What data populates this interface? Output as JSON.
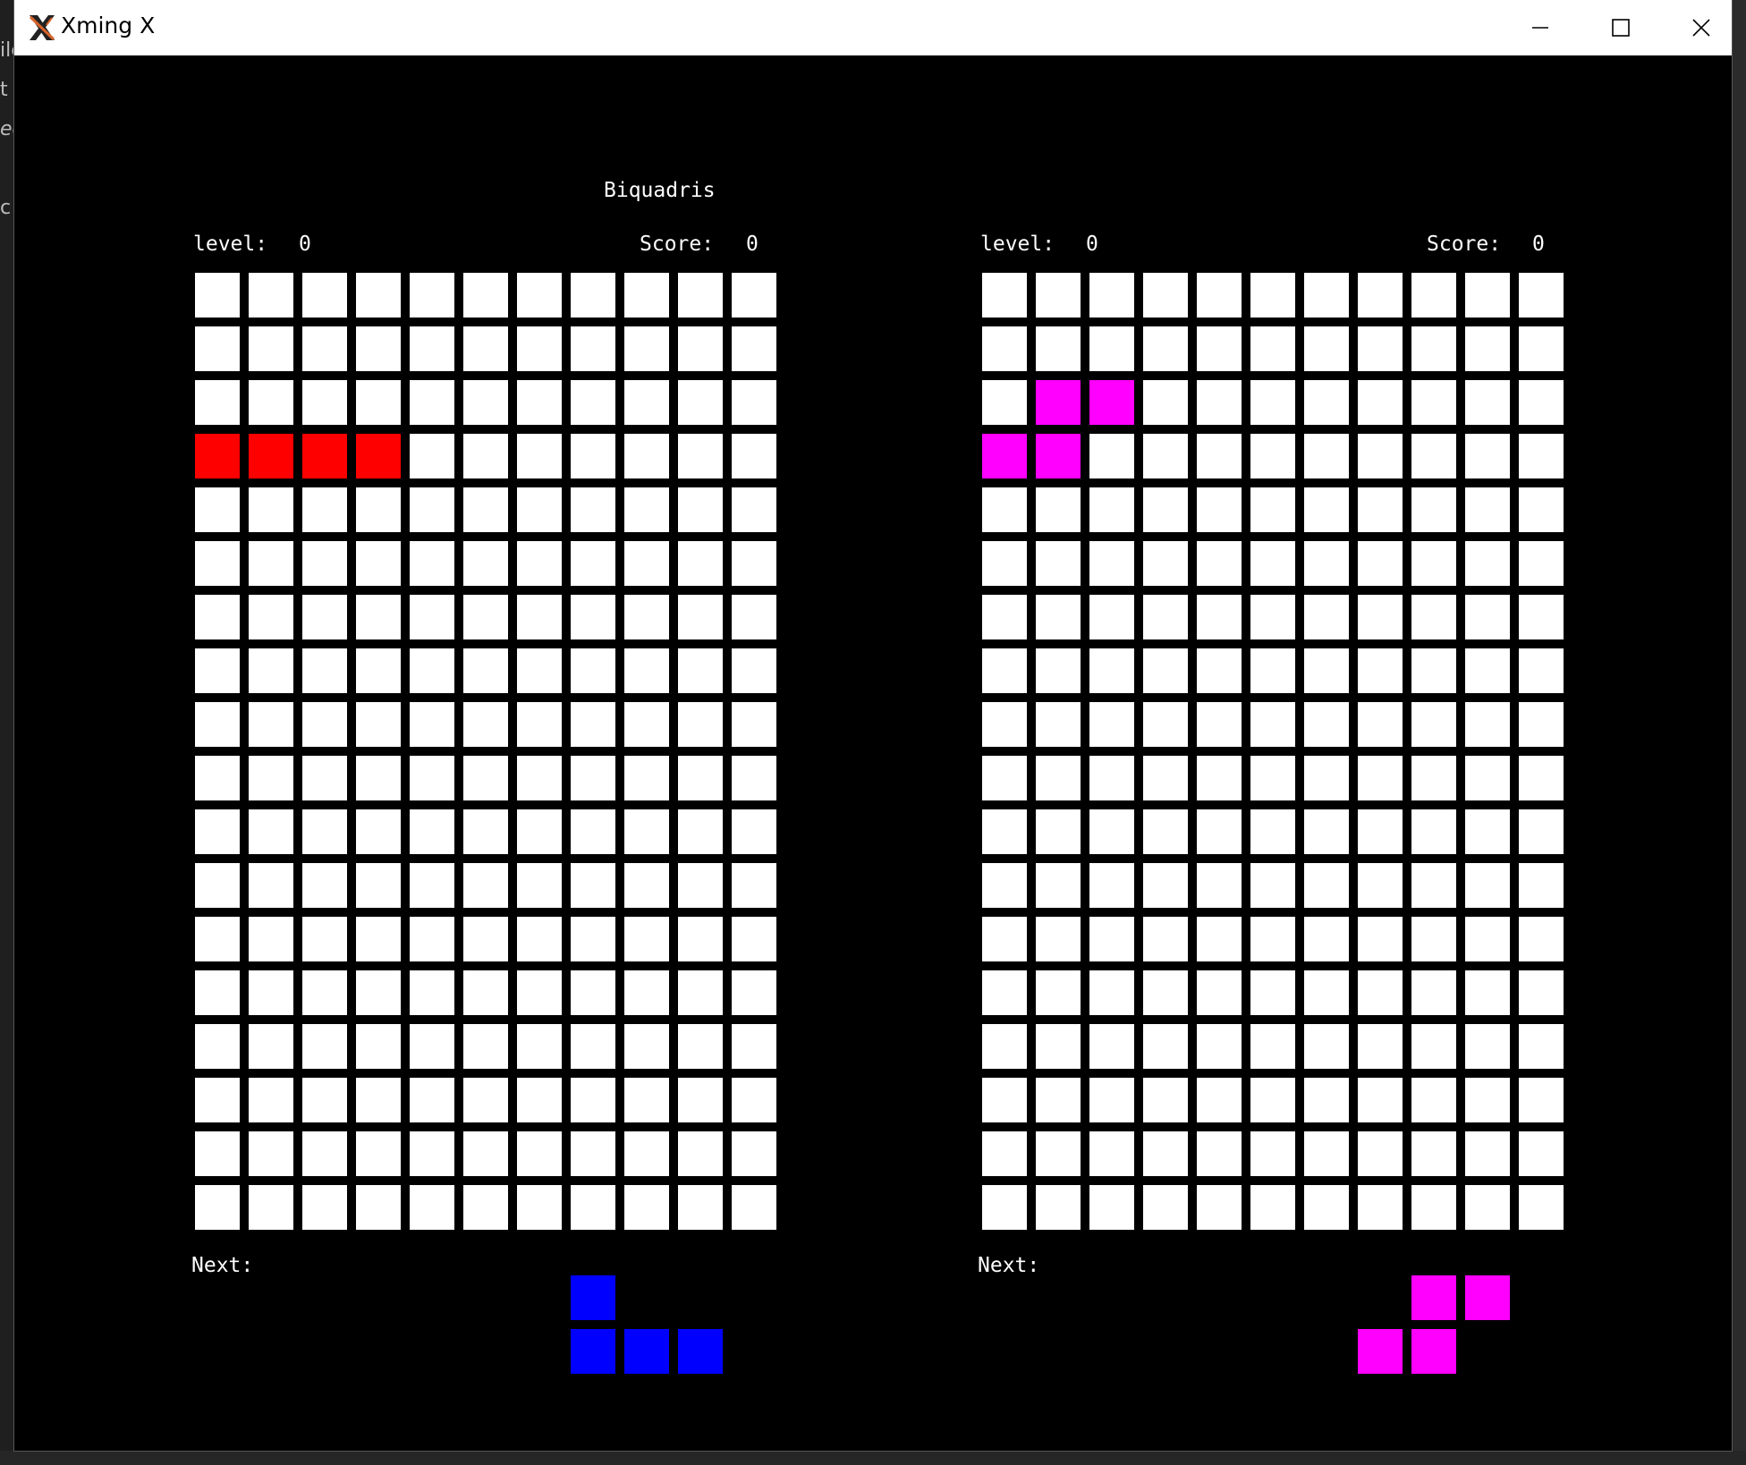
{
  "window": {
    "title": "Xming X",
    "controls": {
      "minimize_icon": "minimize-icon",
      "maximize_icon": "maximize-icon",
      "close_icon": "close-icon"
    }
  },
  "background": {
    "edge_fragments": [
      "ile",
      "t",
      "ec",
      "c"
    ]
  },
  "game": {
    "title": "Biquadris",
    "empty_color": "#ffffff",
    "rows": 18,
    "cols": 11,
    "players": [
      {
        "level_label": "level:",
        "level_value": "0",
        "score_label": "Score:",
        "score_value": "0",
        "next_label": "Next:",
        "current_color": "#ff0000",
        "current_cells": [
          [
            3,
            0
          ],
          [
            3,
            1
          ],
          [
            3,
            2
          ],
          [
            3,
            3
          ]
        ],
        "next_color": "#0000ff",
        "next_cells": [
          [
            0,
            0
          ],
          [
            1,
            0
          ],
          [
            1,
            1
          ],
          [
            1,
            2
          ]
        ]
      },
      {
        "level_label": "level:",
        "level_value": "0",
        "score_label": "Score:",
        "score_value": "0",
        "next_label": "Next:",
        "current_color": "#ff00ff",
        "current_cells": [
          [
            2,
            1
          ],
          [
            2,
            2
          ],
          [
            3,
            0
          ],
          [
            3,
            1
          ]
        ],
        "next_color": "#ff00ff",
        "next_cells": [
          [
            0,
            1
          ],
          [
            0,
            2
          ],
          [
            1,
            0
          ],
          [
            1,
            1
          ]
        ]
      }
    ]
  }
}
